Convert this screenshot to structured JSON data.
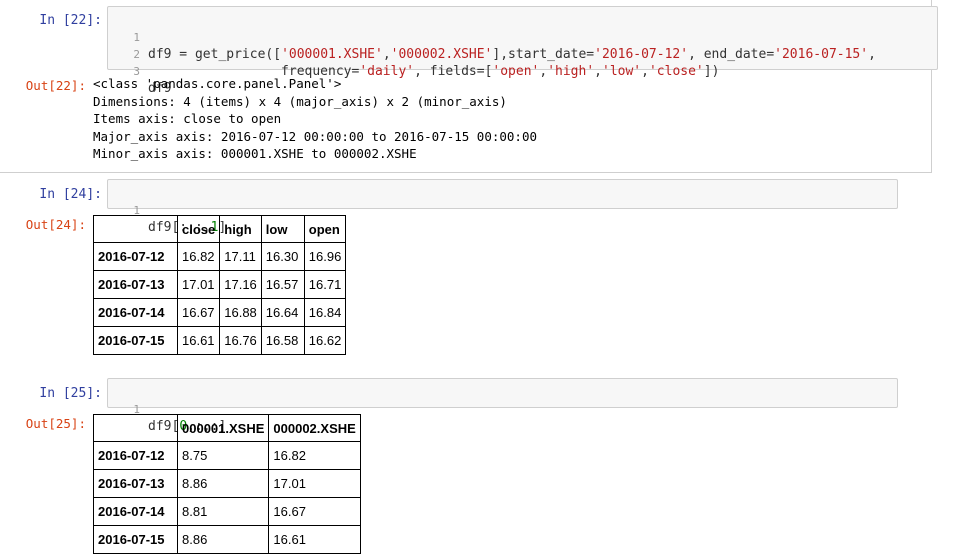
{
  "cells": [
    {
      "in_prompt": "In [22]:",
      "line_numbers": [
        "1",
        "2",
        "3"
      ],
      "out_prompt": "Out[22]:",
      "output_lines": [
        "<class 'pandas.core.panel.Panel'>",
        "Dimensions: 4 (items) x 4 (major_axis) x 2 (minor_axis)",
        "Items axis: close to open",
        "Major_axis axis: 2016-07-12 00:00:00 to 2016-07-15 00:00:00",
        "Minor_axis axis: 000001.XSHE to 000002.XSHE"
      ]
    },
    {
      "in_prompt": "In [24]:",
      "line_numbers": [
        "1"
      ],
      "out_prompt": "Out[24]:",
      "table": {
        "columns": [
          "",
          "close",
          "high",
          "low",
          "open"
        ],
        "rows": [
          [
            "2016-07-12",
            "16.82",
            "17.11",
            "16.30",
            "16.96"
          ],
          [
            "2016-07-13",
            "17.01",
            "17.16",
            "16.57",
            "16.71"
          ],
          [
            "2016-07-14",
            "16.67",
            "16.88",
            "16.64",
            "16.84"
          ],
          [
            "2016-07-15",
            "16.61",
            "16.76",
            "16.58",
            "16.62"
          ]
        ]
      }
    },
    {
      "in_prompt": "In [25]:",
      "line_numbers": [
        "1"
      ],
      "out_prompt": "Out[25]:",
      "table": {
        "columns": [
          "",
          "000001.XSHE",
          "000002.XSHE"
        ],
        "rows": [
          [
            "2016-07-12",
            "8.75",
            "16.82"
          ],
          [
            "2016-07-13",
            "8.86",
            "17.01"
          ],
          [
            "2016-07-14",
            "8.81",
            "16.67"
          ],
          [
            "2016-07-15",
            "8.86",
            "16.61"
          ]
        ]
      }
    }
  ],
  "code": {
    "c22_l1": [
      "df9 = get_price([",
      "'000001.XSHE'",
      ",",
      "'000002.XSHE'",
      "],start_date=",
      "'2016-07-12'",
      ", end_date=",
      "'2016-07-15'",
      ","
    ],
    "c22_l2": [
      "                 frequency=",
      "'daily'",
      ", fields=[",
      "'open'",
      ",",
      "'high'",
      ",",
      "'low'",
      ",",
      "'close'",
      "])"
    ],
    "c22_l3": [
      "df9"
    ],
    "c24_l1": [
      "df9[:,:,",
      "1",
      "]"
    ],
    "c25_l1": [
      "df9[",
      "0",
      ",:,:]"
    ]
  }
}
